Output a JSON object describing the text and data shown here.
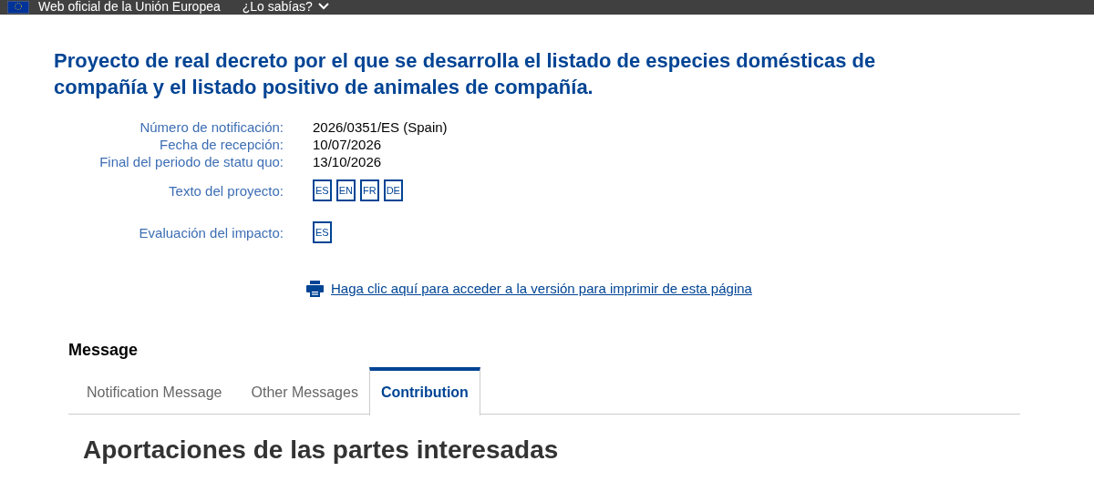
{
  "top_bar": {
    "site": "Web oficial de la Unión Europea",
    "menu": "¿Lo sabías?"
  },
  "title": "Proyecto de real decreto por el que se desarrolla el listado de especies domésticas de compañía y el listado positivo de animales de compañía.",
  "details": [
    {
      "kind": "text",
      "label": "Número de notificación:",
      "value": "2026/0351/ES (Spain)"
    },
    {
      "kind": "text",
      "label": "Fecha de recepción:",
      "value": "10/07/2026"
    },
    {
      "kind": "text",
      "label": "Final del periodo de statu quo:",
      "value": "13/10/2026"
    },
    {
      "kind": "languages",
      "label": "Texto del proyecto:",
      "languages": [
        "ES",
        "EN",
        "FR",
        "DE"
      ]
    },
    {
      "kind": "languages",
      "label": "Evaluación del impacto:",
      "languages": [
        "ES"
      ]
    }
  ],
  "print_link": "Haga clic aquí para acceder a la versión para imprimir de esta página",
  "section_title": "Message",
  "tabs": [
    {
      "label": "Notification Message",
      "selected": false
    },
    {
      "label": "Other Messages",
      "selected": false
    },
    {
      "label": "Contribution",
      "selected": true
    }
  ],
  "content_heading": "Aportaciones de las partes interesadas"
}
